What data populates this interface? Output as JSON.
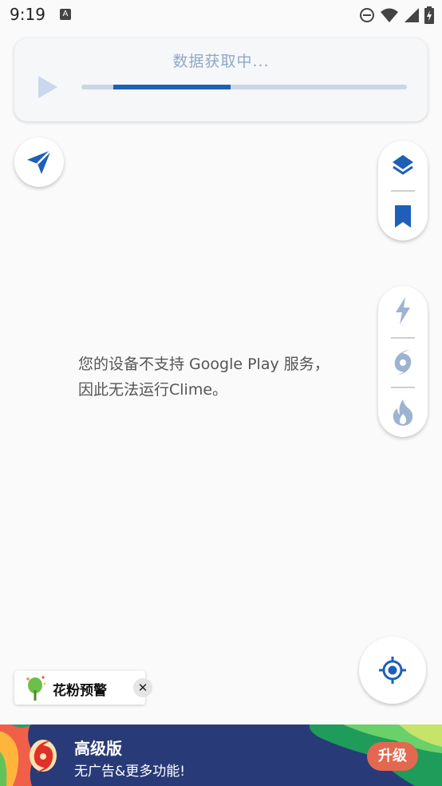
{
  "status_bar": {
    "time": "9:19",
    "a_label": "A"
  },
  "loading": {
    "text": "数据获取中...",
    "progress": 0.36
  },
  "message": {
    "line1": "您的设备不支持 Google Play 服务，",
    "line2": "因此无法运行Clime。"
  },
  "pollen_chip": {
    "label": "花粉预警",
    "close_symbol": "✕"
  },
  "premium_banner": {
    "title": "高级版",
    "subtitle": "无广告&更多功能!",
    "upgrade_label": "升级"
  },
  "colors": {
    "accent_blue": "#1f5fb8",
    "light_blue": "#8fa8c8",
    "banner_bg": "#283a78",
    "upgrade_btn": "#e2684f"
  },
  "icons": {
    "status": [
      "a-icon",
      "dnd-icon",
      "wifi-icon",
      "signal-icon",
      "battery-icon"
    ],
    "map_controls": [
      "send-icon",
      "layers-icon",
      "bookmark-icon",
      "lightning-icon",
      "hurricane-icon",
      "fire-icon",
      "locate-icon",
      "play-icon"
    ]
  }
}
